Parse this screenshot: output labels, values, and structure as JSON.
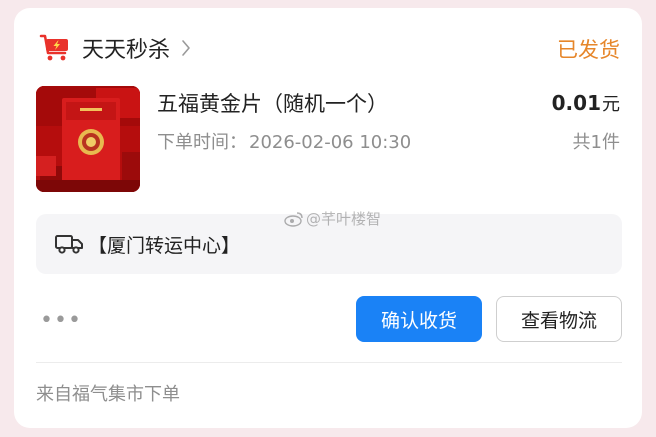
{
  "header": {
    "shop_name": "天天秒杀",
    "status": "已发货"
  },
  "product": {
    "title": "五福黄金片（随机一个）",
    "order_time_label": "下单时间：",
    "order_time": "2026-02-06 10:30",
    "price": "0.01",
    "price_unit": "元",
    "quantity": "共1件"
  },
  "logistics": {
    "text": "【厦门转运中心】"
  },
  "actions": {
    "more": "•••",
    "confirm": "确认收货",
    "track": "查看物流"
  },
  "footer": {
    "source": "来自福气集市下单"
  },
  "watermark": {
    "text": "@芊叶楼智"
  },
  "colors": {
    "accent": "#1a82f6",
    "status": "#e6862a",
    "brand": "#e9322b"
  }
}
